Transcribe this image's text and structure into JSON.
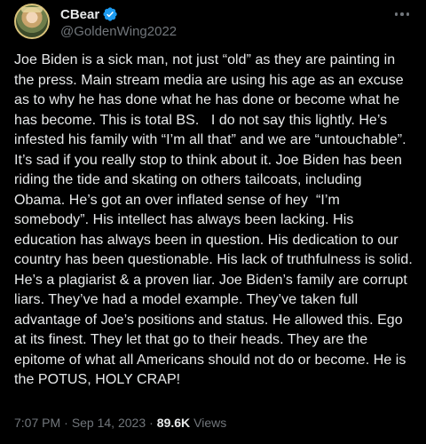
{
  "author": {
    "display_name": "CBear",
    "handle": "@GoldenWing2022",
    "verified": true
  },
  "tweet": {
    "text": "Joe Biden is a sick man, not just “old” as they are painting in the press. Main stream media are using his age as an excuse as to why he has done what he has done or become what he has become. This is total BS.   I do not say this lightly. He’s infested his family with “I’m all that” and we are “untouchable”. It’s sad if you really stop to think about it. Joe Biden has been riding the tide and skating on others tailcoats, including Obama. He’s got an over inflated sense of hey  “I’m somebody”. His intellect has always been lacking. His education has always been in question. His dedication to our country has been questionable. His lack of truthfulness is solid.  He’s a plagiarist & a proven liar. Joe Biden’s family are corrupt liars. They’ve had a model example. They’ve taken full advantage of Joe’s positions and status. He allowed this. Ego at its finest. They let that go to their heads. They are the epitome of what all Americans should not do or become. He is the POTUS, HOLY CRAP!"
  },
  "meta": {
    "time": "7:07 PM",
    "separator": "·",
    "date": "Sep 14, 2023",
    "views_count": "89.6K",
    "views_label": "Views"
  },
  "colors": {
    "background": "#000000",
    "text": "#e7e9ea",
    "secondary": "#71767b",
    "verified": "#1d9bf0"
  }
}
